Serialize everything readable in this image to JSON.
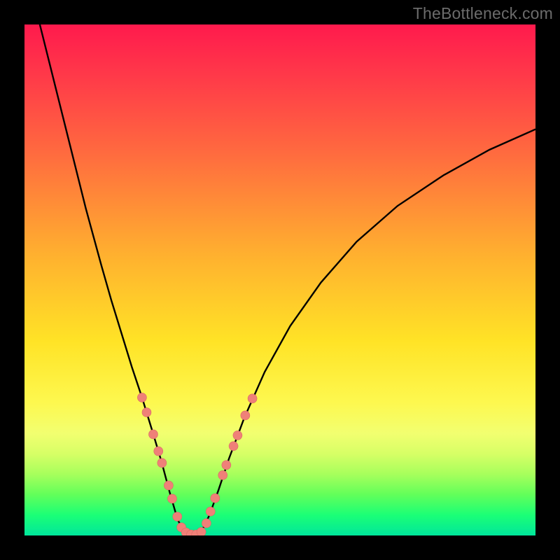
{
  "watermark": "TheBottleneck.com",
  "colors": {
    "curve_stroke": "#000000",
    "dot_fill": "#ef8078",
    "dot_stroke": "#d96a65"
  },
  "chart_data": {
    "type": "line",
    "title": "",
    "xlabel": "",
    "ylabel": "",
    "xlim": [
      0,
      100
    ],
    "ylim": [
      0,
      100
    ],
    "curve": {
      "left": {
        "x": [
          3,
          6,
          9,
          12,
          15,
          17,
          19,
          21,
          23,
          25,
          26.8,
          28.4,
          30,
          31.5
        ],
        "y": [
          100,
          88,
          76,
          64,
          53,
          46,
          39.5,
          33,
          27,
          20.5,
          14.5,
          8.5,
          3,
          0.5
        ]
      },
      "right": {
        "x": [
          34.5,
          36.2,
          38,
          40,
          43,
          47,
          52,
          58,
          65,
          73,
          82,
          91,
          100
        ],
        "y": [
          0.5,
          4,
          9,
          15,
          23,
          32,
          41,
          49.5,
          57.5,
          64.5,
          70.5,
          75.5,
          79.5
        ]
      }
    },
    "minimum": {
      "x": 33,
      "y": 0
    },
    "dots": [
      {
        "x": 23.0,
        "y": 27.0
      },
      {
        "x": 23.9,
        "y": 24.1
      },
      {
        "x": 25.2,
        "y": 19.8
      },
      {
        "x": 26.2,
        "y": 16.5
      },
      {
        "x": 26.9,
        "y": 14.2
      },
      {
        "x": 28.2,
        "y": 9.8
      },
      {
        "x": 28.9,
        "y": 7.2
      },
      {
        "x": 29.9,
        "y": 3.7
      },
      {
        "x": 30.7,
        "y": 1.6
      },
      {
        "x": 31.6,
        "y": 0.6
      },
      {
        "x": 32.6,
        "y": 0.2
      },
      {
        "x": 33.6,
        "y": 0.2
      },
      {
        "x": 34.6,
        "y": 0.7
      },
      {
        "x": 35.6,
        "y": 2.4
      },
      {
        "x": 36.4,
        "y": 4.7
      },
      {
        "x": 37.3,
        "y": 7.3
      },
      {
        "x": 38.8,
        "y": 11.8
      },
      {
        "x": 39.5,
        "y": 13.8
      },
      {
        "x": 40.9,
        "y": 17.5
      },
      {
        "x": 41.7,
        "y": 19.6
      },
      {
        "x": 43.2,
        "y": 23.5
      },
      {
        "x": 44.6,
        "y": 26.8
      }
    ]
  }
}
